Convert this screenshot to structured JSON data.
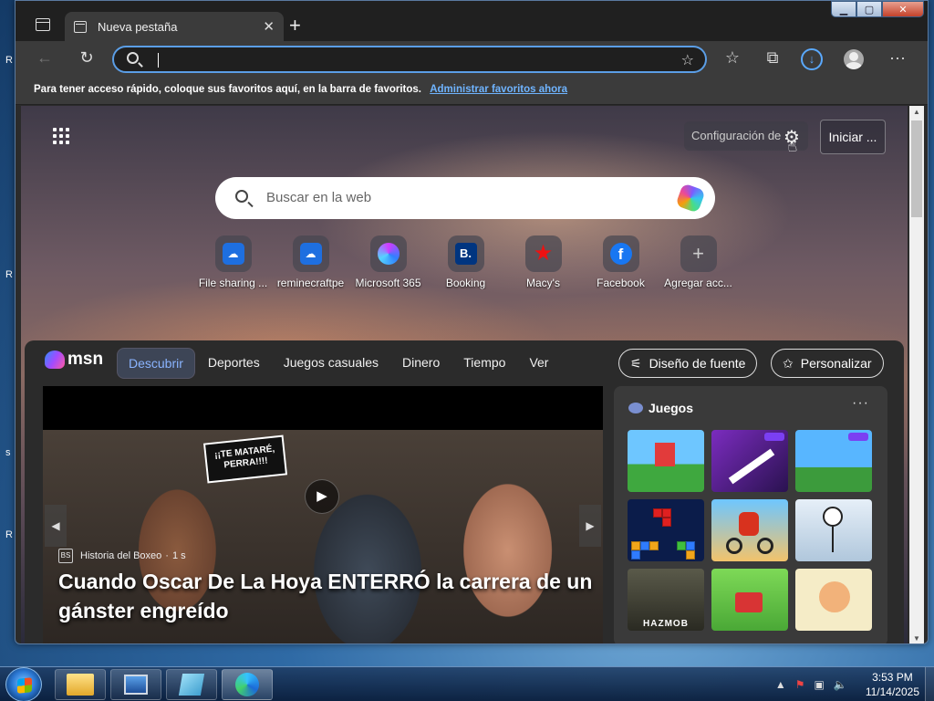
{
  "browser": {
    "tab_title": "Nueva pestaña",
    "new_tab_symbol": "+",
    "tab_close_symbol": "✕",
    "address_value": "",
    "favorites_bar_text": "Para tener acceso rápido, coloque sus favoritos aquí, en la barra de favoritos.",
    "favorites_bar_link": "Administrar favoritos ahora",
    "window_buttons": {
      "minimize": "▁",
      "maximize": "▢",
      "close": "✕"
    }
  },
  "newtab": {
    "settings_label": "Configuración de",
    "signin_label": "Iniciar ...",
    "search_placeholder": "Buscar en la web",
    "quick_links": [
      {
        "label": "File sharing ...",
        "icon": "cloud-icon"
      },
      {
        "label": "reminecraftpe",
        "icon": "cloud-icon"
      },
      {
        "label": "Microsoft 365",
        "icon": "m365-icon"
      },
      {
        "label": "Booking",
        "icon": "booking-icon",
        "glyph": "B."
      },
      {
        "label": "Macy's",
        "icon": "star-icon",
        "glyph": "★"
      },
      {
        "label": "Facebook",
        "icon": "facebook-icon",
        "glyph": "f"
      },
      {
        "label": "Agregar acc...",
        "icon": "plus-icon",
        "glyph": "+"
      }
    ]
  },
  "feed": {
    "logo": "msn",
    "tabs": [
      "Descubrir",
      "Deportes",
      "Juegos casuales",
      "Dinero",
      "Tiempo",
      "Ver"
    ],
    "active_tab": "Descubrir",
    "font_design_label": "Diseño de fuente",
    "customize_label": "Personalizar",
    "hero": {
      "speech_bubble": "¡¡TE MATARÉ, PERRA!!!!",
      "source": "Historia del Boxeo",
      "source_icon_text": "BS",
      "age": "1 s",
      "title": "Cuando Oscar De La Hoya ENTERRÓ la carrera de un gánster engreído"
    },
    "games": {
      "title": "Juegos",
      "more": "···",
      "tiles": [
        "",
        "",
        "",
        "",
        "",
        "",
        "HAZMOB",
        "",
        ""
      ]
    }
  },
  "taskbar": {
    "time": "3:53 PM",
    "date": "11/14/2025"
  },
  "colors": {
    "accent": "#5b9ee6",
    "link": "#6fb4ff",
    "active_tab_text": "#8ab4ff"
  }
}
